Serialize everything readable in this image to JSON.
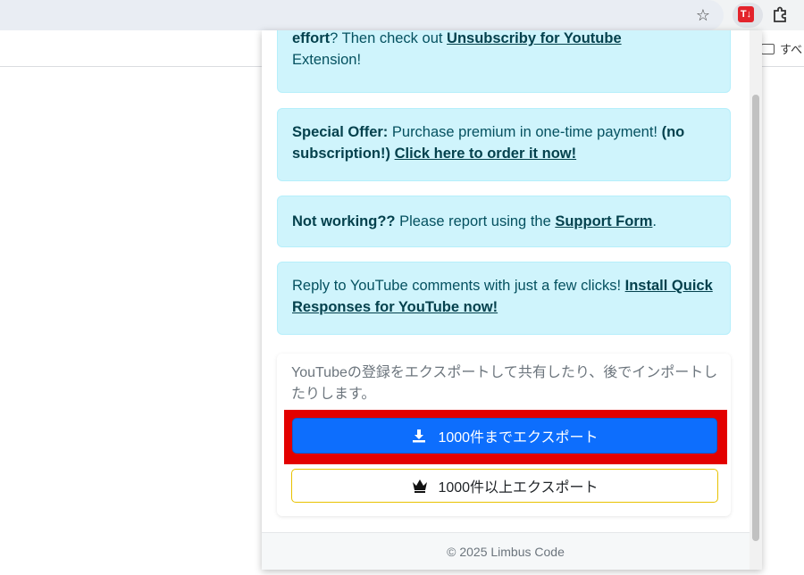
{
  "browser": {
    "bookmark_folder_label": "すべ",
    "extension_logo_text": "T↓",
    "icons": {
      "star": "star-icon",
      "puzzle": "puzzle-icon",
      "folder": "folder-icon"
    }
  },
  "alerts": {
    "a1": {
      "bold": "effort",
      "text": "? Then check out ",
      "link": "Unsubscriby for Youtube",
      "text2": "Extension!"
    },
    "a2": {
      "bold": "Special Offer:",
      "text": " Purchase premium in one-time payment! ",
      "bold2": "(no subscription!)",
      "link": "Click here to order it now!"
    },
    "a3": {
      "bold": "Not working??",
      "text": " Please report using the ",
      "link": "Support Form",
      "text2": "."
    },
    "a4": {
      "text": "Reply to YouTube comments with just a few clicks! ",
      "link": "Install Quick Responses for YouTube now!"
    }
  },
  "export": {
    "description": "YouTubeの登録をエクスポートして共有したり、後でインポートしたりします。",
    "primary_label": "1000件までエクスポート",
    "premium_label": "1000件以上エクスポート",
    "icons": {
      "primary": "download-icon",
      "premium": "crown-icon"
    }
  },
  "footer": {
    "copyright": "© 2025 Limbus Code"
  },
  "colors": {
    "alert_bg": "#cff4fc",
    "alert_text": "#055160",
    "primary": "#0d6efd",
    "highlight": "#e30000",
    "premium_border": "#e8c200"
  }
}
